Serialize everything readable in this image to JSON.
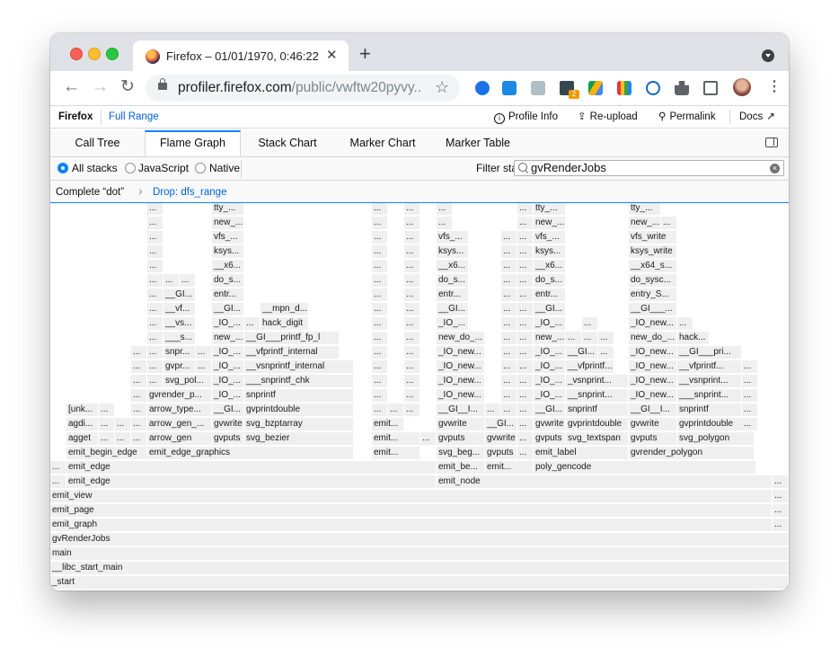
{
  "browser": {
    "tab_title": "Firefox – 01/01/1970, 0:46:22 U",
    "tab_close": "✕",
    "new_tab": "+",
    "url_host": "profiler.firefox.com",
    "url_path": "/public/vwftw20pyvy...",
    "back": "←",
    "forward": "→",
    "reload": "↻",
    "star": "☆",
    "extension_badge": "2",
    "menu": "⋮"
  },
  "profiler_topbar": {
    "brand": "Firefox",
    "range": "Full Range",
    "profile_info": "Profile Info",
    "reupload": "Re-upload",
    "permalink": "Permalink",
    "docs": "Docs",
    "icons": [
      "info-icon",
      "upload-icon",
      "link-icon",
      "external-link-icon"
    ]
  },
  "tabs": [
    "Call Tree",
    "Flame Graph",
    "Stack Chart",
    "Marker Chart",
    "Marker Table"
  ],
  "selected_tab": "Flame Graph",
  "settings": {
    "stack_options": [
      "All stacks",
      "JavaScript",
      "Native"
    ],
    "selected_stack": "All stacks",
    "filter_label": "Filter stacks:",
    "filter_value": "gvRenderJobs"
  },
  "breadcrumbs": [
    "Complete “dot”",
    "Drop: dfs_range"
  ],
  "flame_rows": [
    [
      [
        0,
        "_start",
        822
      ]
    ],
    [
      [
        0,
        "__libc_start_main",
        822
      ]
    ],
    [
      [
        0,
        "main",
        822
      ]
    ],
    [
      [
        0,
        "gvRenderJobs",
        822
      ]
    ],
    [
      [
        0,
        "emit_graph",
        804
      ],
      [
        804,
        "...",
        18
      ]
    ],
    [
      [
        0,
        "emit_page",
        804
      ],
      [
        804,
        "...",
        18
      ]
    ],
    [
      [
        0,
        "emit_view",
        804
      ],
      [
        804,
        "...",
        18
      ]
    ],
    [
      [
        0,
        "...",
        18
      ],
      [
        18,
        "emit_edge",
        412
      ],
      [
        430,
        "emit_node",
        374
      ],
      [
        804,
        "...",
        18
      ]
    ],
    [
      [
        0,
        "...",
        18
      ],
      [
        18,
        "emit_edge",
        412
      ],
      [
        430,
        "emit_be...",
        54
      ],
      [
        484,
        "emit...",
        54
      ],
      [
        538,
        "poly_gencode",
        248
      ]
    ],
    [
      [
        18,
        "emit_begin_edge",
        90
      ],
      [
        108,
        "emit_edge_graphics",
        230
      ],
      [
        358,
        "emit...",
        54
      ],
      [
        430,
        "svg_beg...",
        54
      ],
      [
        484,
        "gvputs",
        36
      ],
      [
        520,
        "...",
        18
      ],
      [
        538,
        "emit_label",
        106
      ],
      [
        644,
        "gvrender_polygon",
        140
      ]
    ],
    [
      [
        18,
        "agget",
        36
      ],
      [
        54,
        "...",
        18
      ],
      [
        72,
        "...",
        18
      ],
      [
        90,
        "...",
        18
      ],
      [
        108,
        "arrow_gen",
        72
      ],
      [
        180,
        "gvputs",
        36
      ],
      [
        216,
        "svg_bezier",
        122
      ],
      [
        358,
        "emit...",
        54
      ],
      [
        412,
        "...",
        18
      ],
      [
        430,
        "gvputs",
        54
      ],
      [
        484,
        "gvwrite",
        36
      ],
      [
        520,
        "...",
        18
      ],
      [
        538,
        "gvputs",
        36
      ],
      [
        574,
        "svg_textspan",
        70
      ],
      [
        644,
        "gvputs",
        54
      ],
      [
        698,
        "svg_polygon",
        86
      ]
    ],
    [
      [
        18,
        "agdi...",
        36
      ],
      [
        54,
        "...",
        18
      ],
      [
        72,
        "...",
        18
      ],
      [
        90,
        "...",
        18
      ],
      [
        108,
        "arrow_gen_...",
        72
      ],
      [
        180,
        "gvwrite",
        36
      ],
      [
        216,
        "svg_bzptarray",
        122
      ],
      [
        358,
        "emit...",
        36
      ],
      [
        430,
        "gvwrite",
        54
      ],
      [
        484,
        "__GI...",
        36
      ],
      [
        520,
        "...",
        18
      ],
      [
        538,
        "gvwrite",
        36
      ],
      [
        574,
        "gvprintdouble",
        70
      ],
      [
        644,
        "gvwrite",
        54
      ],
      [
        698,
        "gvprintdouble",
        86
      ],
      [
        770,
        "...",
        18
      ]
    ],
    [
      [
        18,
        "[unk...",
        36
      ],
      [
        54,
        "...",
        18
      ],
      [
        90,
        "...",
        18
      ],
      [
        108,
        "arrow_type...",
        72
      ],
      [
        180,
        "__GI...",
        36
      ],
      [
        216,
        "gvprintdouble",
        122
      ],
      [
        358,
        "...",
        18
      ],
      [
        376,
        "...",
        18
      ],
      [
        394,
        "...",
        18
      ],
      [
        430,
        "__GI__I...",
        54
      ],
      [
        484,
        "...",
        18
      ],
      [
        502,
        "...",
        18
      ],
      [
        520,
        "...",
        18
      ],
      [
        538,
        "__GI...",
        36
      ],
      [
        574,
        "snprintf",
        70
      ],
      [
        644,
        "__GI__I...",
        54
      ],
      [
        698,
        "snprintf",
        72
      ],
      [
        770,
        "...",
        18
      ]
    ],
    [
      [
        90,
        "...",
        18
      ],
      [
        108,
        "gvrender_p...",
        72
      ],
      [
        180,
        "_IO_...",
        36
      ],
      [
        216,
        "snprintf",
        122
      ],
      [
        358,
        "...",
        18
      ],
      [
        394,
        "...",
        18
      ],
      [
        430,
        "_IO_new...",
        54
      ],
      [
        502,
        "...",
        18
      ],
      [
        520,
        "...",
        18
      ],
      [
        538,
        "_IO_...",
        36
      ],
      [
        574,
        "__snprint...",
        70
      ],
      [
        644,
        "_IO_new...",
        54
      ],
      [
        698,
        "___snprint...",
        72
      ],
      [
        770,
        "...",
        18
      ]
    ],
    [
      [
        90,
        "...",
        18
      ],
      [
        108,
        "...",
        18
      ],
      [
        126,
        "svg_pol...",
        54
      ],
      [
        180,
        "_IO_...",
        36
      ],
      [
        216,
        "___snprintf_chk",
        122
      ],
      [
        358,
        "...",
        18
      ],
      [
        394,
        "...",
        18
      ],
      [
        430,
        "_IO_new...",
        54
      ],
      [
        502,
        "...",
        18
      ],
      [
        520,
        "...",
        18
      ],
      [
        538,
        "_IO_...",
        36
      ],
      [
        574,
        "_vsnprint...",
        70
      ],
      [
        644,
        "_IO_new...",
        54
      ],
      [
        698,
        "__vsnprint...",
        72
      ],
      [
        770,
        "...",
        18
      ]
    ],
    [
      [
        90,
        "...",
        18
      ],
      [
        108,
        "...",
        18
      ],
      [
        126,
        "gvpr...",
        36
      ],
      [
        162,
        "...",
        18
      ],
      [
        180,
        "_IO_...",
        36
      ],
      [
        216,
        "__vsnprintf_internal",
        122
      ],
      [
        358,
        "...",
        18
      ],
      [
        394,
        "...",
        18
      ],
      [
        430,
        "_IO_new...",
        54
      ],
      [
        502,
        "...",
        18
      ],
      [
        520,
        "...",
        18
      ],
      [
        538,
        "_IO_...",
        36
      ],
      [
        574,
        "__vfprintf...",
        54
      ],
      [
        644,
        "_IO_new...",
        54
      ],
      [
        698,
        "__vfprintf...",
        72
      ],
      [
        770,
        "...",
        18
      ]
    ],
    [
      [
        90,
        "...",
        18
      ],
      [
        108,
        "...",
        18
      ],
      [
        126,
        "snpr...",
        36
      ],
      [
        162,
        "...",
        18
      ],
      [
        180,
        "_IO_...",
        36
      ],
      [
        216,
        "__vfprintf_internal",
        106
      ],
      [
        358,
        "...",
        18
      ],
      [
        394,
        "...",
        18
      ],
      [
        430,
        "_IO_new...",
        54
      ],
      [
        502,
        "...",
        18
      ],
      [
        520,
        "...",
        18
      ],
      [
        538,
        "_IO_...",
        36
      ],
      [
        574,
        "__GI...",
        36
      ],
      [
        610,
        "...",
        18
      ],
      [
        644,
        "_IO_new...",
        54
      ],
      [
        698,
        "__GI___pri...",
        72
      ]
    ],
    [
      [
        108,
        "...",
        18
      ],
      [
        126,
        "___s...",
        36
      ],
      [
        180,
        "new_...",
        36
      ],
      [
        216,
        "__GI___printf_fp_l",
        106
      ],
      [
        358,
        "...",
        18
      ],
      [
        394,
        "...",
        18
      ],
      [
        430,
        "new_do_...",
        54
      ],
      [
        502,
        "...",
        18
      ],
      [
        520,
        "...",
        18
      ],
      [
        538,
        "new_...",
        36
      ],
      [
        574,
        "...",
        18
      ],
      [
        592,
        "...",
        18
      ],
      [
        610,
        "...",
        18
      ],
      [
        644,
        "new_do_...",
        54
      ],
      [
        698,
        "hack...",
        36
      ]
    ],
    [
      [
        108,
        "...",
        18
      ],
      [
        126,
        "__vs...",
        36
      ],
      [
        180,
        "_IO_...",
        36
      ],
      [
        216,
        "...",
        18
      ],
      [
        234,
        "hack_digit",
        54
      ],
      [
        358,
        "...",
        18
      ],
      [
        394,
        "...",
        18
      ],
      [
        430,
        "_IO_...",
        36
      ],
      [
        502,
        "...",
        18
      ],
      [
        520,
        "...",
        18
      ],
      [
        538,
        "_IO_...",
        36
      ],
      [
        592,
        "...",
        18
      ],
      [
        644,
        "_IO_new...",
        54
      ],
      [
        698,
        "...",
        18
      ]
    ],
    [
      [
        108,
        "...",
        18
      ],
      [
        126,
        "__vf...",
        36
      ],
      [
        180,
        "__GI...",
        36
      ],
      [
        234,
        "__mpn_d...",
        54
      ],
      [
        358,
        "...",
        18
      ],
      [
        394,
        "...",
        18
      ],
      [
        430,
        "__GI...",
        36
      ],
      [
        502,
        "...",
        18
      ],
      [
        520,
        "...",
        18
      ],
      [
        538,
        "__GI...",
        36
      ],
      [
        644,
        "__GI___...",
        54
      ]
    ],
    [
      [
        108,
        "...",
        18
      ],
      [
        126,
        "__GI...",
        36
      ],
      [
        180,
        "entr...",
        36
      ],
      [
        358,
        "...",
        18
      ],
      [
        394,
        "...",
        18
      ],
      [
        430,
        "entr...",
        36
      ],
      [
        502,
        "...",
        18
      ],
      [
        520,
        "...",
        18
      ],
      [
        538,
        "entr...",
        36
      ],
      [
        644,
        "entry_S...",
        54
      ]
    ],
    [
      [
        108,
        "...",
        18
      ],
      [
        126,
        "...",
        18
      ],
      [
        144,
        "...",
        18
      ],
      [
        180,
        "do_s...",
        36
      ],
      [
        358,
        "...",
        18
      ],
      [
        394,
        "...",
        18
      ],
      [
        430,
        "do_s...",
        36
      ],
      [
        502,
        "...",
        18
      ],
      [
        520,
        "...",
        18
      ],
      [
        538,
        "do_s...",
        36
      ],
      [
        644,
        "do_sysc...",
        54
      ]
    ],
    [
      [
        108,
        "...",
        18
      ],
      [
        180,
        "__x6...",
        36
      ],
      [
        358,
        "...",
        18
      ],
      [
        394,
        "...",
        18
      ],
      [
        430,
        "__x6...",
        36
      ],
      [
        502,
        "...",
        18
      ],
      [
        520,
        "...",
        18
      ],
      [
        538,
        "__x6...",
        36
      ],
      [
        644,
        "__x64_s...",
        54
      ]
    ],
    [
      [
        108,
        "...",
        18
      ],
      [
        180,
        "ksys...",
        36
      ],
      [
        358,
        "...",
        18
      ],
      [
        394,
        "...",
        18
      ],
      [
        430,
        "ksys...",
        36
      ],
      [
        502,
        "...",
        18
      ],
      [
        520,
        "...",
        18
      ],
      [
        538,
        "ksys...",
        36
      ],
      [
        644,
        "ksys_write",
        54
      ]
    ],
    [
      [
        108,
        "...",
        18
      ],
      [
        180,
        "vfs_...",
        36
      ],
      [
        358,
        "...",
        18
      ],
      [
        394,
        "...",
        18
      ],
      [
        430,
        "vfs_...",
        36
      ],
      [
        502,
        "...",
        18
      ],
      [
        520,
        "...",
        18
      ],
      [
        538,
        "vfs_...",
        36
      ],
      [
        644,
        "vfs_write",
        54
      ]
    ],
    [
      [
        108,
        "...",
        18
      ],
      [
        180,
        "new_...",
        36
      ],
      [
        358,
        "...",
        18
      ],
      [
        394,
        "...",
        18
      ],
      [
        430,
        "...",
        18
      ],
      [
        520,
        "...",
        18
      ],
      [
        538,
        "new_...",
        36
      ],
      [
        644,
        "new_...",
        36
      ],
      [
        680,
        "...",
        18
      ]
    ],
    [
      [
        108,
        "...",
        18
      ],
      [
        180,
        "tty_...",
        36
      ],
      [
        358,
        "...",
        18
      ],
      [
        394,
        "...",
        18
      ],
      [
        430,
        "...",
        18
      ],
      [
        520,
        "...",
        18
      ],
      [
        538,
        "tty_...",
        36
      ],
      [
        644,
        "tty_...",
        36
      ]
    ]
  ]
}
